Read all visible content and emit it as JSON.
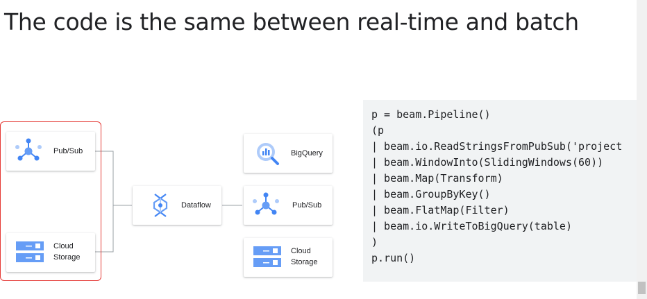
{
  "title": "The code is the same between real-time and batch",
  "sources": {
    "pubsub": {
      "label": "Pub/Sub",
      "icon": "pubsub-icon"
    },
    "storage": {
      "label_line1": "Cloud",
      "label_line2": "Storage",
      "icon": "cloud-storage-icon"
    }
  },
  "processor": {
    "label": "Dataflow",
    "icon": "dataflow-icon"
  },
  "sinks": {
    "bigquery": {
      "label": "BigQuery",
      "icon": "bigquery-icon"
    },
    "pubsub": {
      "label": "Pub/Sub",
      "icon": "pubsub-icon"
    },
    "storage": {
      "label_line1": "Cloud",
      "label_line2": "Storage",
      "icon": "cloud-storage-icon"
    }
  },
  "code_lines": [
    "p = beam.Pipeline()",
    "(p",
    "| beam.io.ReadStringsFromPubSub('project",
    "| beam.WindowInto(SlidingWindows(60))",
    "| beam.Map(Transform)",
    "| beam.GroupByKey()",
    "| beam.FlatMap(Filter)",
    "| beam.io.WriteToBigQuery(table)",
    ")",
    "p.run()"
  ],
  "colors": {
    "highlight_border": "#e53935",
    "google_blue": "#4285f4",
    "code_bg": "#f1f3f4",
    "text": "#202124"
  }
}
